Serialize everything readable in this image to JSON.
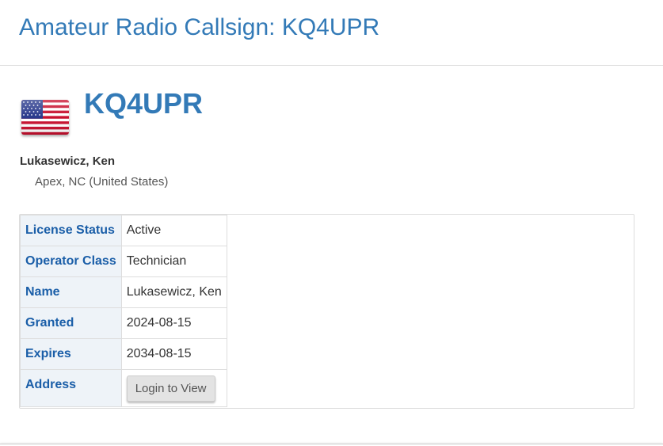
{
  "page": {
    "title": "Amateur Radio Callsign: KQ4UPR"
  },
  "profile": {
    "flag_icon": "us-flag-icon",
    "callsign": "KQ4UPR",
    "name": "Lukasewicz, Ken",
    "location": "Apex, NC (United States)"
  },
  "license_table": {
    "rows": [
      {
        "label": "License Status",
        "value": "Active"
      },
      {
        "label": "Operator Class",
        "value": "Technician"
      },
      {
        "label": "Name",
        "value": "Lukasewicz, Ken"
      },
      {
        "label": "Granted",
        "value": "2024-08-15"
      },
      {
        "label": "Expires",
        "value": "2034-08-15"
      },
      {
        "label": "Address",
        "button_label": "Login to View"
      }
    ]
  },
  "colors": {
    "accent": "#337ab7",
    "label_text": "#1a5ea8",
    "label_background": "#eef3f8",
    "border": "#dddddd"
  }
}
